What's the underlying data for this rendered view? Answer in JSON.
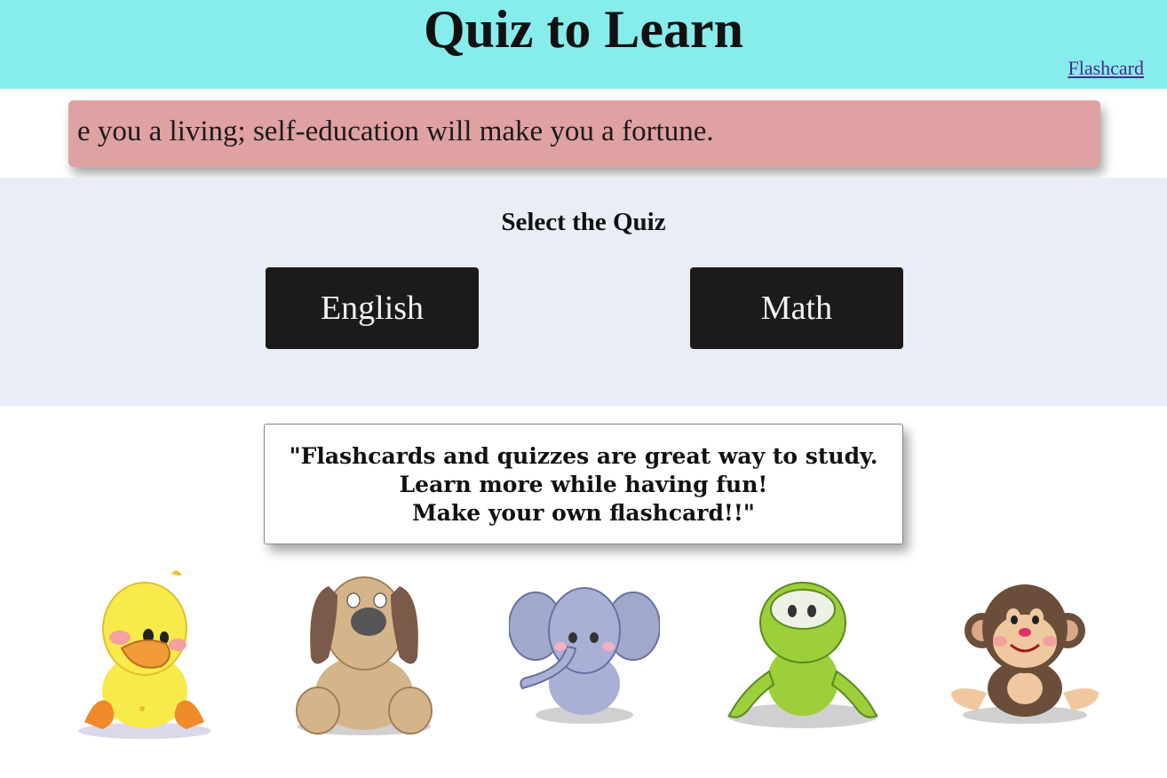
{
  "header": {
    "title": "Quiz to Learn",
    "flashcard_link": "Flashcard",
    "background": "#87ecec"
  },
  "marquee": {
    "text": "e you a living; self-education will make you a fortune.",
    "background": "#e0a1a2"
  },
  "quiz": {
    "heading": "Select the Quiz",
    "buttons": [
      {
        "label": "English"
      },
      {
        "label": "Math"
      }
    ],
    "background": "#e9edf5",
    "button_color": "#1c1a1a"
  },
  "quote": {
    "lines": [
      "\"Flashcards and quizzes are great way to study.",
      "Learn more while having fun!",
      "Make your own flashcard!!\""
    ]
  },
  "animals": [
    {
      "icon": "duck-icon"
    },
    {
      "icon": "dog-icon"
    },
    {
      "icon": "elephant-icon"
    },
    {
      "icon": "frog-icon"
    },
    {
      "icon": "monkey-icon"
    }
  ]
}
